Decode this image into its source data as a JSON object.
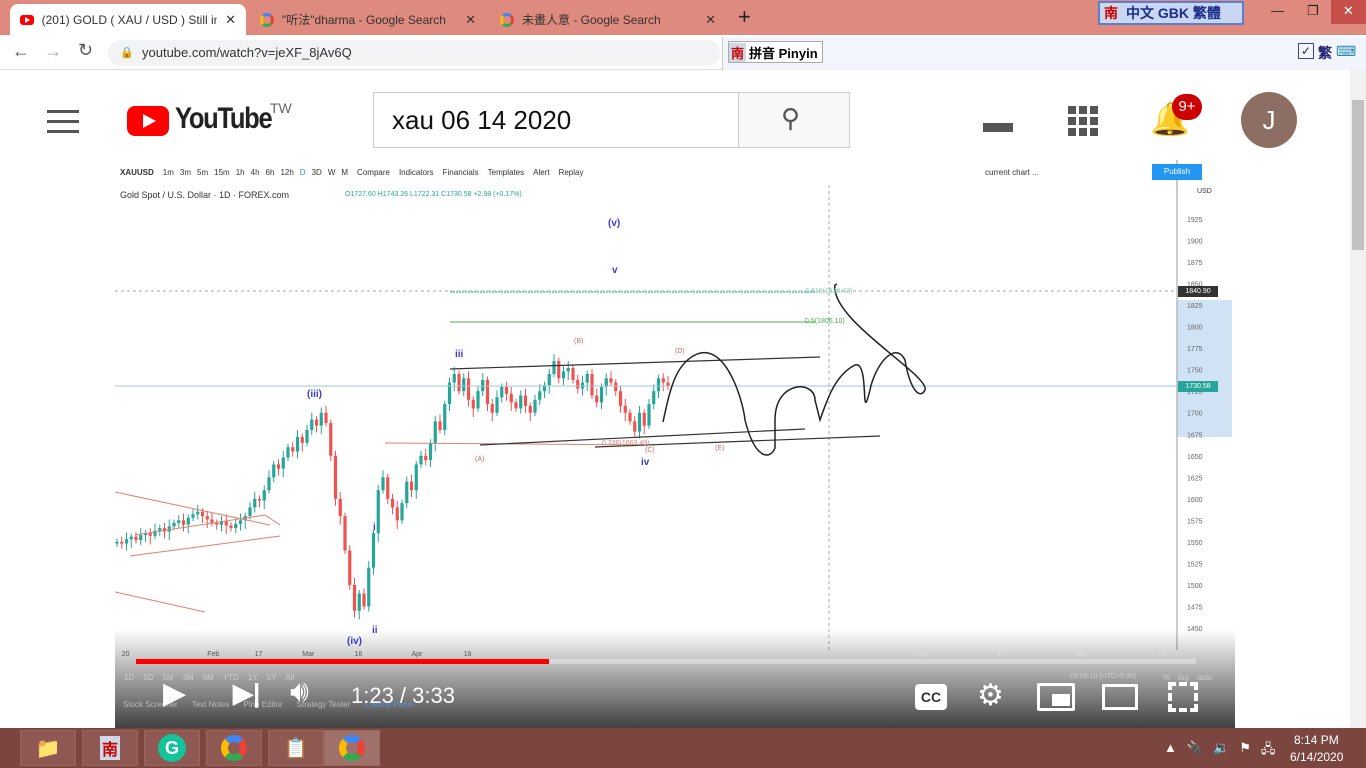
{
  "browser": {
    "tabs": [
      {
        "title": "(201) GOLD ( XAU / USD ) Still in",
        "active": true
      },
      {
        "title": "\"听法\"dharma - Google Search",
        "active": false
      },
      {
        "title": "未畫人意 - Google Search",
        "active": false
      }
    ],
    "new_tab": "+",
    "url": "youtube.com/watch?v=jeXF_8jAv6Q",
    "ime_top": {
      "logo": "南",
      "label": "中文 GBK 繁體"
    },
    "ime_bar": {
      "logo": "南",
      "label": "拼音 Pinyin",
      "trad": "繁"
    }
  },
  "youtube": {
    "logo": "YouTube",
    "region": "TW",
    "search_value": "xau 06 14 2020",
    "notifications": "9+",
    "avatar": "J"
  },
  "tradingview": {
    "symbol": "XAUUSD",
    "intervals": [
      "1m",
      "3m",
      "5m",
      "15m",
      "1h",
      "4h",
      "6h",
      "12h",
      "D",
      "3D",
      "W",
      "M"
    ],
    "toolbar": [
      "Compare",
      "Indicators",
      "Financials",
      "Templates",
      "Alert",
      "Replay"
    ],
    "layout": "current chart ...",
    "publish": "Publish",
    "instrument": "Gold Spot / U.S. Dollar · 1D · FOREX.com",
    "ohlc": "O1727.60 H1743.26 L1722.31 C1730.58 +2.98 (+0.17%)",
    "currency": "USD",
    "price_tag": "1730.58",
    "cursor_tag": "1840.90",
    "fib_618": "0.618(1838.42)",
    "fib_5": "0.5(1806.10)",
    "fib_236": "0.236(1663.49)",
    "waves": {
      "v_paren": "(v)",
      "v": "v",
      "iii_paren": "(iii)",
      "iii": "iii",
      "iv_paren": "(iv)",
      "iv": "iv",
      "i": "i",
      "ii": "ii",
      "A": "(A)",
      "B": "(B)",
      "C": "(C)",
      "D": "(D)",
      "E": "(E)"
    },
    "ranges": [
      "1D",
      "5D",
      "1M",
      "3M",
      "6M",
      "YTD",
      "1Y",
      "5Y",
      "All"
    ],
    "bottom_tabs": [
      "Stock Screener",
      "Text Notes",
      "Pine Editor",
      "Strategy Tester",
      "Trading Panel"
    ],
    "time_readout": "03:09:10 (UTC+5:30)",
    "scale_opts": [
      "%",
      "log",
      "auto"
    ],
    "x_ticks": [
      {
        "l": "20",
        "i": 1
      },
      {
        "l": "Feb",
        "i": 19
      },
      {
        "l": "17",
        "i": 29
      },
      {
        "l": "Mar",
        "i": 39
      },
      {
        "l": "16",
        "i": 50
      },
      {
        "l": "Apr",
        "i": 62
      },
      {
        "l": "16",
        "i": 73
      }
    ],
    "x_ticks_future": [
      "Aug",
      "17",
      "Sep",
      "14"
    ]
  },
  "chart_data": {
    "type": "candlestick",
    "title": "Gold Spot / U.S. Dollar · 1D",
    "ylim": [
      1440,
      1935
    ],
    "y_ticks": [
      1925,
      1900,
      1875,
      1850,
      1825,
      1800,
      1775,
      1750,
      1725,
      1700,
      1675,
      1650,
      1625,
      1600,
      1575,
      1550,
      1525,
      1500,
      1475,
      1450
    ],
    "closes": [
      1550,
      1548,
      1553,
      1556,
      1552,
      1558,
      1560,
      1557,
      1563,
      1566,
      1562,
      1568,
      1572,
      1575,
      1570,
      1578,
      1582,
      1585,
      1580,
      1576,
      1572,
      1570,
      1574,
      1569,
      1566,
      1571,
      1575,
      1580,
      1590,
      1600,
      1598,
      1610,
      1625,
      1640,
      1635,
      1648,
      1660,
      1655,
      1672,
      1665,
      1680,
      1692,
      1685,
      1700,
      1688,
      1650,
      1600,
      1580,
      1540,
      1500,
      1470,
      1490,
      1475,
      1520,
      1560,
      1610,
      1625,
      1600,
      1590,
      1575,
      1595,
      1620,
      1610,
      1640,
      1650,
      1645,
      1665,
      1690,
      1680,
      1710,
      1735,
      1745,
      1725,
      1740,
      1715,
      1705,
      1725,
      1738,
      1710,
      1700,
      1718,
      1730,
      1722,
      1712,
      1705,
      1720,
      1708,
      1700,
      1715,
      1725,
      1732,
      1745,
      1760,
      1740,
      1748,
      1752,
      1738,
      1728,
      1735,
      1745,
      1720,
      1712,
      1730,
      1740,
      1735,
      1725,
      1708,
      1700,
      1690,
      1678,
      1700,
      1685,
      1710,
      1725,
      1740,
      1735,
      1730.58
    ],
    "up_color": "#26a69a",
    "down_color": "#ef5350"
  },
  "player": {
    "time": "1:23 / 3:33",
    "progress": 0.39,
    "cc": "CC"
  },
  "taskbar": {
    "time": "8:14 PM",
    "date": "6/14/2020"
  }
}
